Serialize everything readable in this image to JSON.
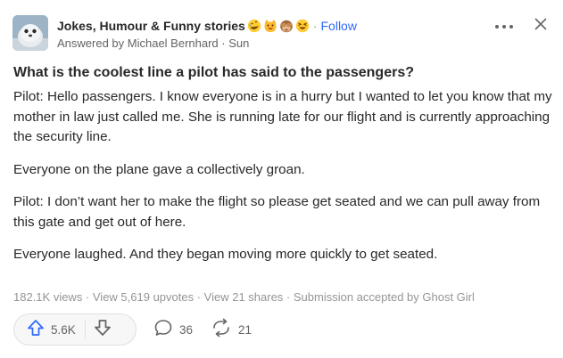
{
  "header": {
    "space_name": "Jokes, Humour & Funny stories",
    "separator": "·",
    "follow_label": "Follow",
    "byline": "Answered by Michael Bernhard · Sun",
    "emojis": [
      "rolling-on-floor-laughing",
      "grinning-cat",
      "see-no-evil-monkey",
      "laughing-squinting-face"
    ]
  },
  "question": "What is the coolest line a pilot has said to the passengers?",
  "answer": {
    "p1": "Pilot: Hello passengers. I know everyone is in a hurry but I wanted to let you know that my mother in law just called me. She is running late for our flight and is currently approaching the security line.",
    "p2": "Everyone on the plane gave a collectively groan.",
    "p3": "Pilot: I don’t want her to make the flight so please get seated and we can pull away from this gate and get out of here.",
    "p4": "Everyone laughed. And they began moving more quickly to get seated."
  },
  "stats": "182.1K views · View 5,619 upvotes · View 21 shares · Submission accepted by Ghost Girl",
  "actions": {
    "upvote_count": "5.6K",
    "comment_count": "36",
    "share_count": "21"
  },
  "icons": {
    "more": "more-horizontal-icon",
    "close": "close-icon",
    "upvote": "upvote-arrow-icon",
    "downvote": "downvote-arrow-icon",
    "comment": "comment-bubble-icon",
    "share": "share-arrows-icon"
  },
  "colors": {
    "accent": "#2e69ff",
    "text": "#282829",
    "muted": "#636466",
    "faint": "#939598"
  }
}
